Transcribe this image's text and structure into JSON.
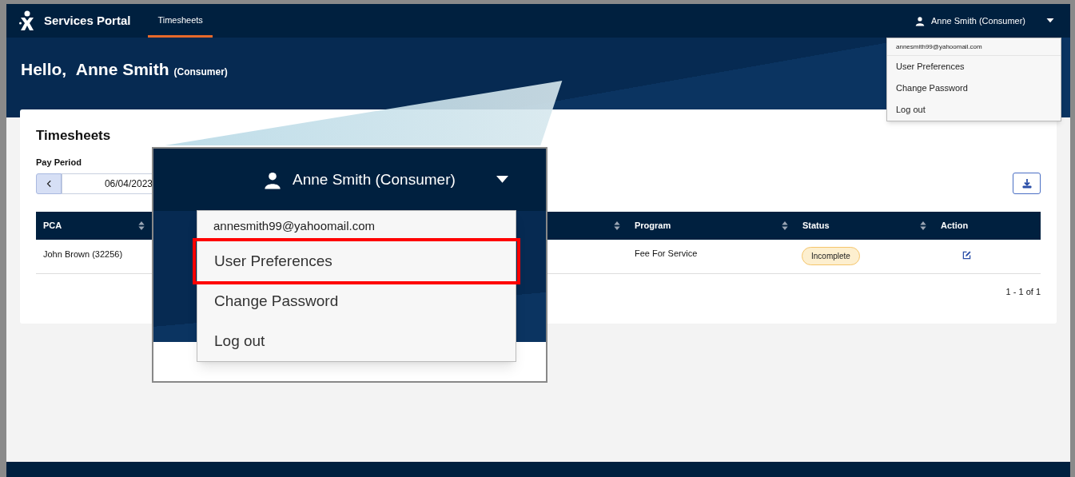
{
  "header": {
    "brand": "Services Portal",
    "nav": [
      {
        "label": "Timesheets",
        "selected": true
      }
    ],
    "user": "Anne Smith (Consumer)"
  },
  "user_menu": {
    "email": "annesmith99@yahoomail.com",
    "items": [
      {
        "label": "User Preferences",
        "highlighted": false
      },
      {
        "label": "Change Password",
        "highlighted": false
      },
      {
        "label": "Log out",
        "highlighted": false
      }
    ]
  },
  "greeting": {
    "hello": "Hello,",
    "name": "Anne Smith",
    "role": "(Consumer)"
  },
  "card": {
    "title": "Timesheets",
    "pay_period_label": "Pay Period",
    "pay_period": "06/04/2023",
    "table": {
      "columns": [
        {
          "label": "PCA",
          "sortable": true
        },
        {
          "sortable": true
        },
        {
          "label": "Program",
          "sortable": true
        },
        {
          "label": "Status",
          "sortable": true
        },
        {
          "label": "Action",
          "sortable": false
        }
      ],
      "rows": [
        {
          "pca": "John Brown (32256)",
          "program": "Fee For Service",
          "status": "Incomplete"
        }
      ]
    },
    "pagination": "1 - 1 of 1"
  },
  "callout": {
    "user": "Anne Smith (Consumer)",
    "email": "annesmith99@yahoomail.com",
    "items": [
      {
        "label": "User Preferences",
        "highlighted": true
      },
      {
        "label": "Change Password",
        "highlighted": false
      },
      {
        "label": "Log out",
        "highlighted": false
      }
    ]
  }
}
